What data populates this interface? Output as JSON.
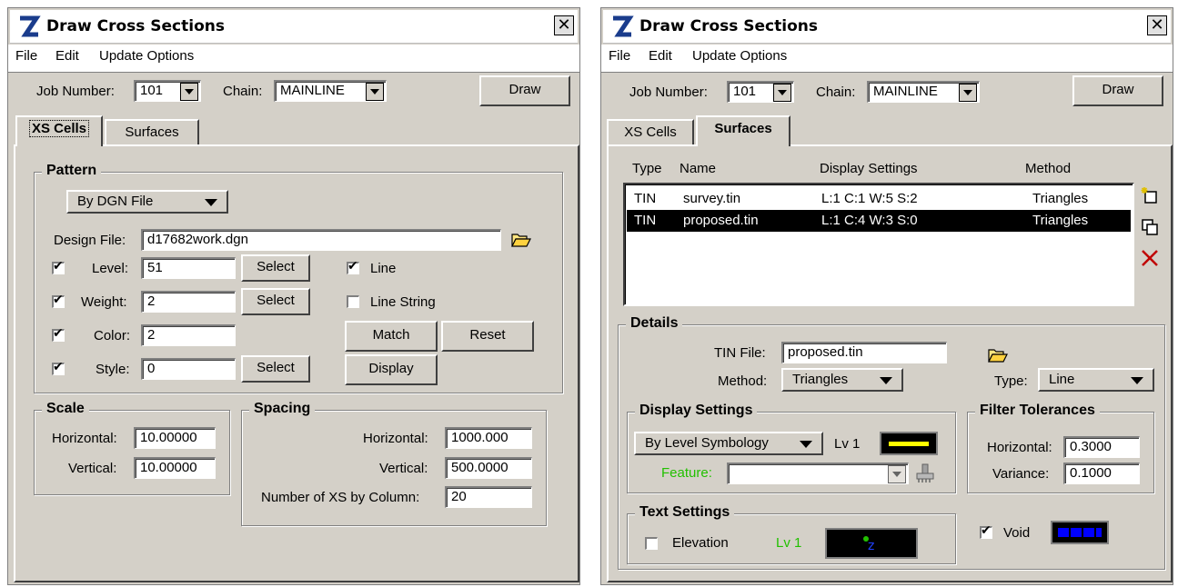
{
  "left_window": {
    "title": "Draw Cross Sections",
    "close_label": "✕",
    "menu": [
      "File",
      "Edit",
      "Update Options"
    ],
    "job_number_label": "Job Number:",
    "job_number": "101",
    "chain_label": "Chain:",
    "chain": "MAINLINE",
    "draw_label": "Draw",
    "tabs": [
      {
        "label": "XS Cells",
        "active": true
      },
      {
        "label": "Surfaces",
        "active": false
      }
    ],
    "pattern": {
      "title": "Pattern",
      "mode": "By DGN File",
      "design_file_label": "Design File:",
      "design_file": "d17682work.dgn",
      "level_label": "Level:",
      "level": "51",
      "weight_label": "Weight:",
      "weight": "2",
      "color_label": "Color:",
      "color": "2",
      "style_label": "Style:",
      "style": "0",
      "select_label": "Select",
      "line_label": "Line",
      "line_string_label": "Line String",
      "match_label": "Match",
      "reset_label": "Reset",
      "display_label": "Display"
    },
    "scale": {
      "title": "Scale",
      "horizontal_label": "Horizontal:",
      "horizontal": "10.00000",
      "vertical_label": "Vertical:",
      "vertical": "10.00000"
    },
    "spacing": {
      "title": "Spacing",
      "horizontal_label": "Horizontal:",
      "horizontal": "1000.000",
      "vertical_label": "Vertical:",
      "vertical": "500.0000",
      "columns_label": "Number of XS by Column:",
      "columns": "20"
    }
  },
  "right_window": {
    "title": "Draw Cross Sections",
    "close_label": "✕",
    "menu": [
      "File",
      "Edit",
      "Update Options"
    ],
    "job_number_label": "Job Number:",
    "job_number": "101",
    "chain_label": "Chain:",
    "chain": "MAINLINE",
    "draw_label": "Draw",
    "tabs": [
      {
        "label": "XS Cells",
        "active": false
      },
      {
        "label": "Surfaces",
        "active": true
      }
    ],
    "list_headers": {
      "type": "Type",
      "name": "Name",
      "display": "Display Settings",
      "method": "Method"
    },
    "surfaces": [
      {
        "type": "TIN",
        "name": "survey.tin",
        "display": "L:1 C:1 W:5 S:2",
        "method": "Triangles",
        "selected": false
      },
      {
        "type": "TIN",
        "name": "proposed.tin",
        "display": "L:1 C:4 W:3 S:0",
        "method": "Triangles",
        "selected": true
      }
    ],
    "details": {
      "title": "Details",
      "tin_file_label": "TIN File:",
      "tin_file": "proposed.tin",
      "method_label": "Method:",
      "method": "Triangles",
      "type_label": "Type:",
      "type": "Line"
    },
    "display_settings": {
      "title": "Display Settings",
      "mode": "By Level Symbology",
      "level": "Lv 1",
      "feature_label": "Feature:",
      "swatch_color": "#ffff00"
    },
    "filter_tolerances": {
      "title": "Filter Tolerances",
      "horizontal_label": "Horizontal:",
      "horizontal": "0.3000",
      "variance_label": "Variance:",
      "variance": "0.1000"
    },
    "text_settings": {
      "title": "Text Settings",
      "elevation_label": "Elevation",
      "level": "Lv 1"
    },
    "void_label": "Void",
    "void_color": "#0000ff"
  }
}
